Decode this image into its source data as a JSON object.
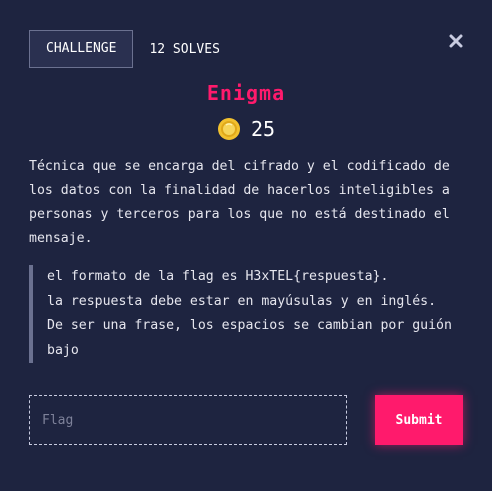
{
  "tabs": [
    {
      "label": "CHALLENGE",
      "active": true
    },
    {
      "label": "12 SOLVES",
      "active": false
    }
  ],
  "challenge": {
    "title": "Enigma",
    "points": "25",
    "description": "Técnica que se encarga del cifrado y el codificado de los datos con la finalidad de hacerlos inteligibles a personas y terceros para los que no está destinado el mensaje.",
    "hint_lines": [
      "el formato de la flag es H3xTEL{respuesta}.",
      "la respuesta debe estar en mayúsulas y en inglés.",
      "De ser una frase, los espacios se cambian por guión bajo"
    ]
  },
  "form": {
    "flag_placeholder": "Flag",
    "submit_label": "Submit"
  },
  "icons": {
    "close": "close-icon",
    "points": "coin-icon"
  },
  "colors": {
    "background": "#1e2440",
    "accent": "#ff1a6c",
    "coin": "#f2c12e"
  }
}
